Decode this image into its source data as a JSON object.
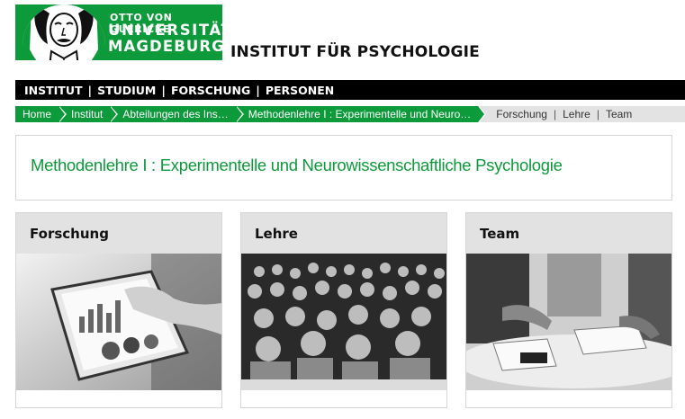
{
  "logo": {
    "line1": "OTTO VON GUERICKE",
    "line2": "UNIVERSITÄT",
    "line3": "MAGDEBURG",
    "brand_color": "#0c9a3a"
  },
  "institute_title": "INSTITUT FÜR PSYCHOLOGIE",
  "main_nav": {
    "items": [
      "INSTITUT",
      "STUDIUM",
      "FORSCHUNG",
      "PERSONEN"
    ],
    "separator": "|"
  },
  "breadcrumb": {
    "items": [
      "Home",
      "Institut",
      "Abteilungen des Ins…",
      "Methodenlehre I : Experimentelle und Neuro…"
    ],
    "sub_links": [
      "Forschung",
      "Lehre",
      "Team"
    ],
    "separator": "|"
  },
  "page_heading": "Methodenlehre I : Experimentelle und Neurowissenschaftliche Psychologie",
  "cards": [
    {
      "title": "Forschung",
      "image": "tablet-chart-photo"
    },
    {
      "title": "Lehre",
      "image": "lecture-hall-photo"
    },
    {
      "title": "Team",
      "image": "team-meeting-photo"
    }
  ]
}
